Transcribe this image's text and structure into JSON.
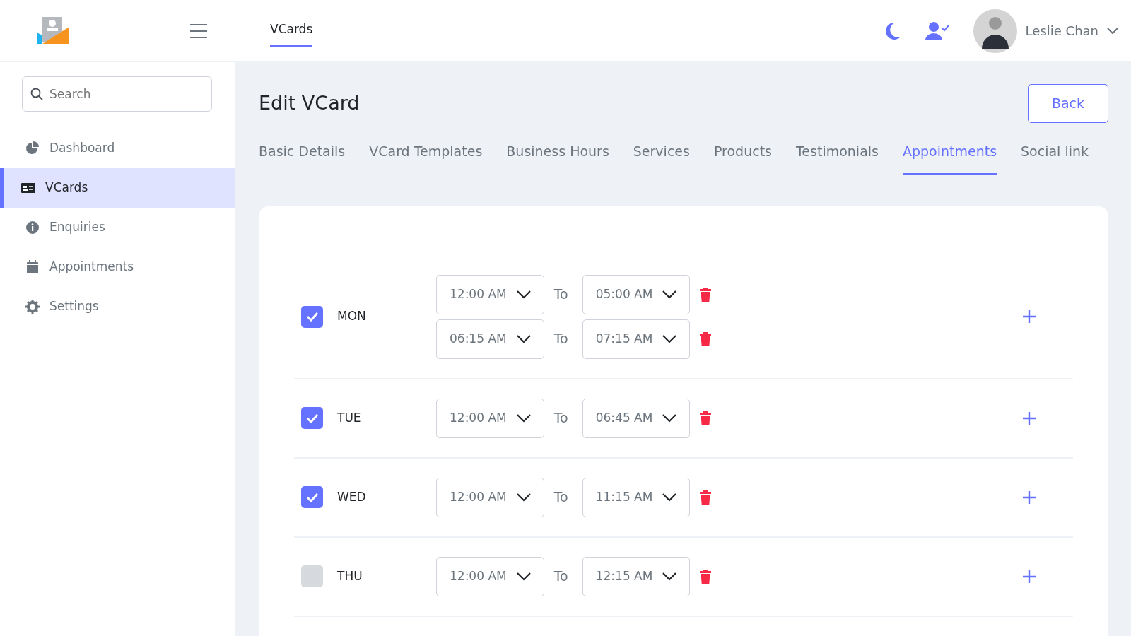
{
  "header": {
    "nav_tab": {
      "label": "VCards",
      "selected": true
    },
    "user": {
      "name": "Leslie Chan"
    }
  },
  "sidebar": {
    "search": {
      "placeholder": "Search"
    },
    "items": [
      {
        "label": "Dashboard",
        "kind": "dashboard",
        "selected": false
      },
      {
        "label": "VCards",
        "kind": "vcards",
        "selected": true
      },
      {
        "label": "Enquiries",
        "kind": "enquiries",
        "selected": false
      },
      {
        "label": "Appointments",
        "kind": "appointments",
        "selected": false
      },
      {
        "label": "Settings",
        "kind": "settings",
        "selected": false
      }
    ]
  },
  "page": {
    "title": "Edit VCard",
    "back_button": "Back",
    "tabs": [
      {
        "label": "Basic Details",
        "selected": false
      },
      {
        "label": "VCard Templates",
        "selected": false
      },
      {
        "label": "Business Hours",
        "selected": false
      },
      {
        "label": "Services",
        "selected": false
      },
      {
        "label": "Products",
        "selected": false
      },
      {
        "label": "Testimonials",
        "selected": false
      },
      {
        "label": "Appointments",
        "selected": true
      },
      {
        "label": "Social link",
        "selected": false
      }
    ]
  },
  "days": [
    {
      "day": "MON",
      "checked": true,
      "slots": [
        {
          "from": "12:00 AM",
          "to_label": "To",
          "to": "05:00 AM"
        },
        {
          "from": "06:15 AM",
          "to_label": "To",
          "to": "07:15 AM"
        }
      ]
    },
    {
      "day": "TUE",
      "checked": true,
      "slots": [
        {
          "from": "12:00 AM",
          "to_label": "To",
          "to": "06:45 AM"
        }
      ]
    },
    {
      "day": "WED",
      "checked": true,
      "slots": [
        {
          "from": "12:00 AM",
          "to_label": "To",
          "to": "11:15 AM"
        }
      ]
    },
    {
      "day": "THU",
      "checked": false,
      "slots": [
        {
          "from": "12:00 AM",
          "to_label": "To",
          "to": "12:15 AM"
        }
      ]
    }
  ]
}
